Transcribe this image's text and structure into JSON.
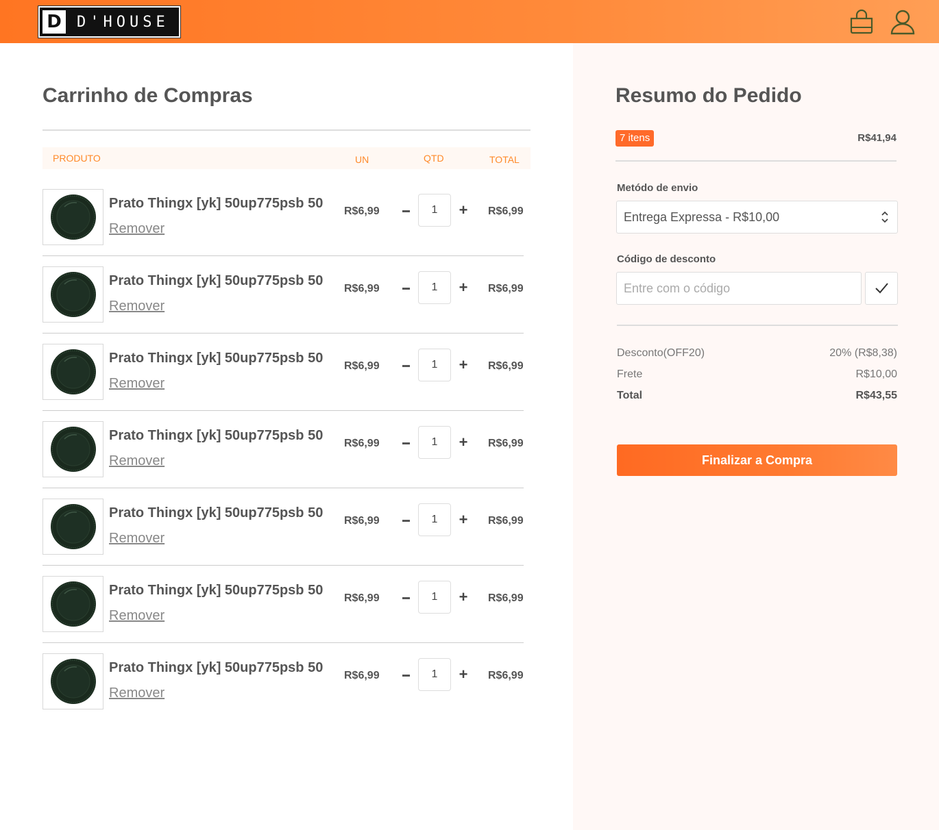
{
  "brand": {
    "logo_mark": "D",
    "logo_text": "D'HOUSE"
  },
  "cart": {
    "title": "Carrinho de Compras",
    "columns": {
      "product": "PRODUTO",
      "unit": "UN",
      "qty": "QTD",
      "total": "TOTAL"
    },
    "items": [
      {
        "name": "Prato Thingx [yk] 50up775psb 50",
        "remove": "Remover",
        "unit_price": "R$6,99",
        "qty": "1",
        "total": "R$6,99"
      },
      {
        "name": "Prato Thingx [yk] 50up775psb 50",
        "remove": "Remover",
        "unit_price": "R$6,99",
        "qty": "1",
        "total": "R$6,99"
      },
      {
        "name": "Prato Thingx [yk] 50up775psb 50",
        "remove": "Remover",
        "unit_price": "R$6,99",
        "qty": "1",
        "total": "R$6,99"
      },
      {
        "name": "Prato Thingx [yk] 50up775psb 50",
        "remove": "Remover",
        "unit_price": "R$6,99",
        "qty": "1",
        "total": "R$6,99"
      },
      {
        "name": "Prato Thingx [yk] 50up775psb 50",
        "remove": "Remover",
        "unit_price": "R$6,99",
        "qty": "1",
        "total": "R$6,99"
      },
      {
        "name": "Prato Thingx [yk] 50up775psb 50",
        "remove": "Remover",
        "unit_price": "R$6,99",
        "qty": "1",
        "total": "R$6,99"
      },
      {
        "name": "Prato Thingx [yk] 50up775psb 50",
        "remove": "Remover",
        "unit_price": "R$6,99",
        "qty": "1",
        "total": "R$6,99"
      }
    ],
    "plus_symbol": "+"
  },
  "summary": {
    "title": "Resumo do Pedido",
    "items_badge": "7 itens",
    "subtotal": "R$41,94",
    "shipping_label": "Metódo de envio",
    "shipping_selected": "Entrega Expressa - R$10,00",
    "code_label": "Código de desconto",
    "code_placeholder": "Entre com o código",
    "discount_label": "Desconto(OFF20)",
    "discount_value": "20% (R$8,38)",
    "freight_label": "Frete",
    "freight_value": "R$10,00",
    "total_label": "Total",
    "total_value": "R$43,55",
    "checkout_label": "Finalizar a Compra"
  },
  "colors": {
    "accent": "#ff7522",
    "badge": "#ff6a2a",
    "icon_green": "#4a5a2a",
    "plate": "#1e2e22"
  },
  "icons": {
    "cart": "shopping-bag-icon",
    "account": "user-icon",
    "select": "chevron-up-down-icon",
    "apply": "check-icon"
  }
}
